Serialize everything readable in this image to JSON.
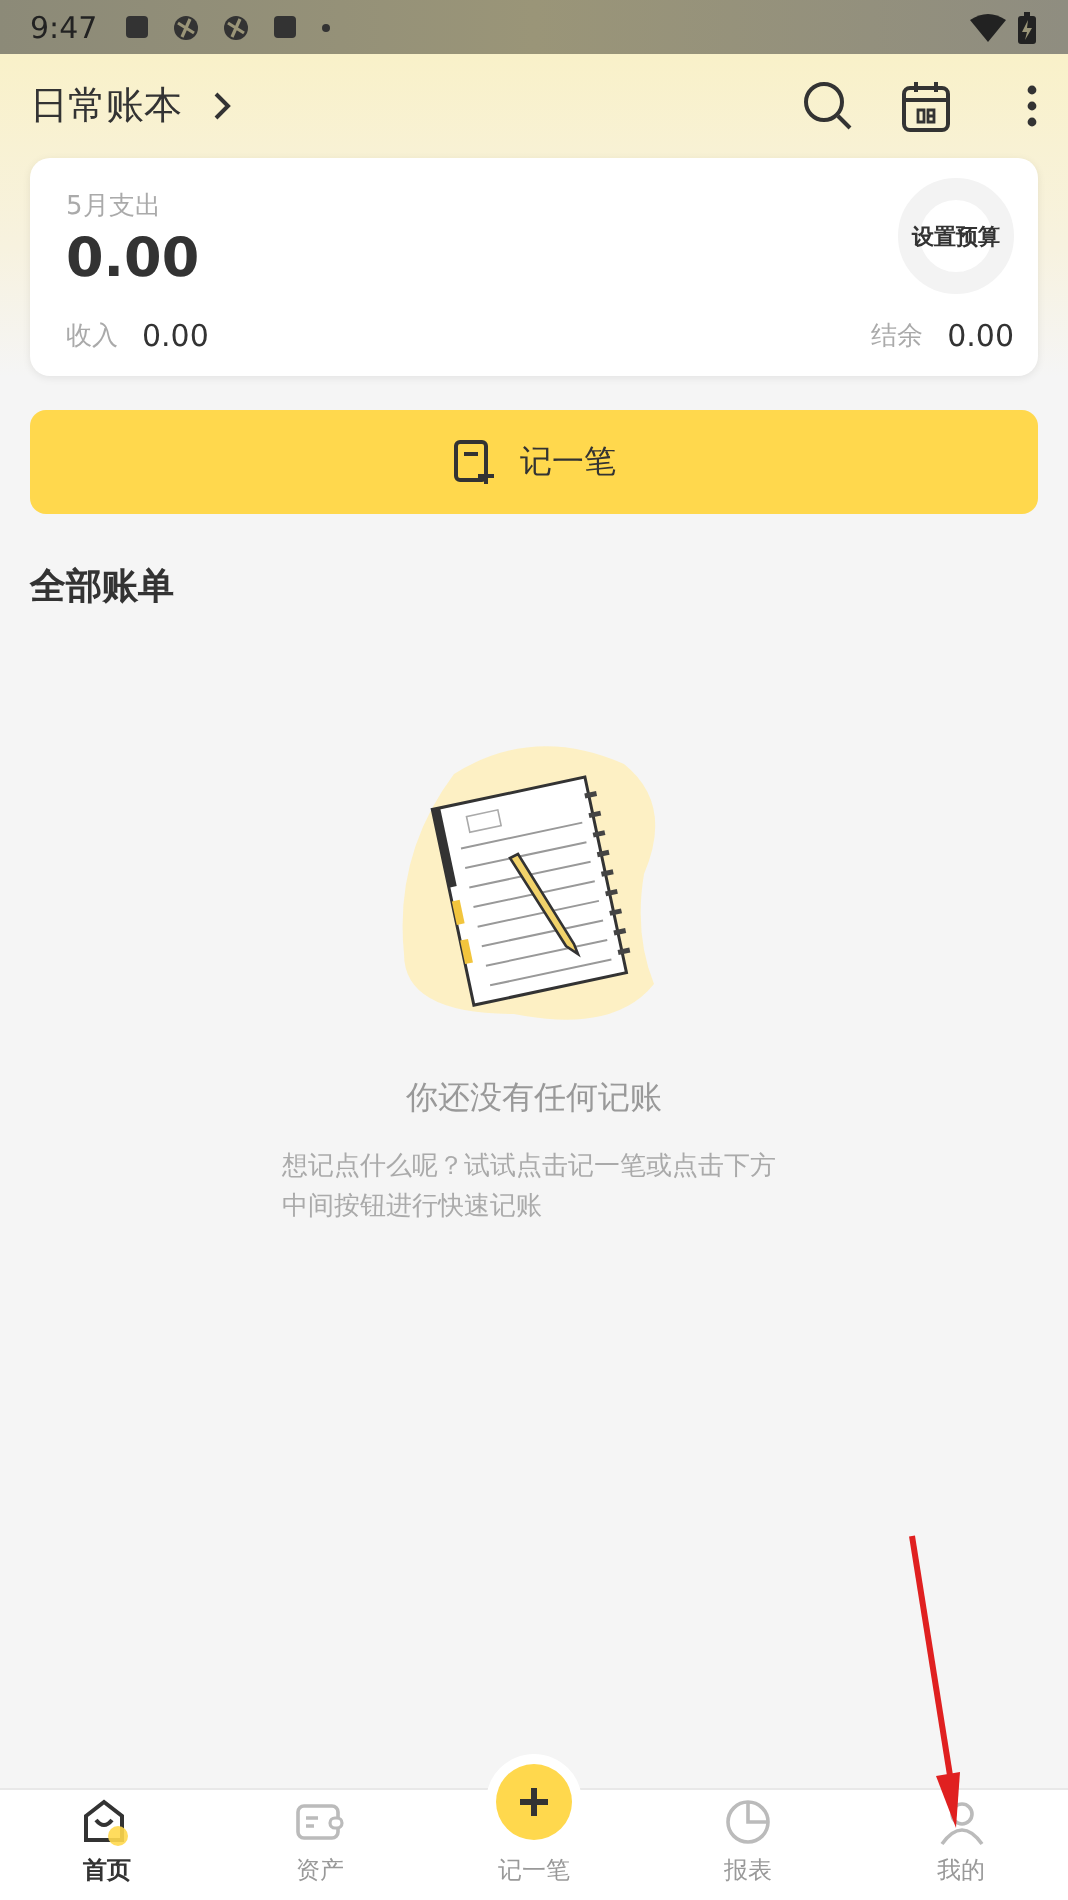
{
  "status_bar": {
    "time": "9:47"
  },
  "header": {
    "title": "日常账本"
  },
  "summary": {
    "month_label": "5月支出",
    "expense": "0.00",
    "budget_button": "设置预算",
    "income_label": "收入",
    "income": "0.00",
    "balance_label": "结余",
    "balance": "0.00"
  },
  "add_button": {
    "label": "记一笔"
  },
  "section_title": "全部账单",
  "empty_state": {
    "title": "你还没有任何记账",
    "message": "想记点什么呢？试试点击记一笔或点击下方中间按钮进行快速记账"
  },
  "bottom_nav": [
    {
      "kind": "home",
      "label": "首页",
      "selected": true
    },
    {
      "kind": "wallet",
      "label": "资产",
      "selected": false
    },
    {
      "kind": "add",
      "label": "记一笔",
      "selected": false
    },
    {
      "kind": "report",
      "label": "报表",
      "selected": false
    },
    {
      "kind": "profile",
      "label": "我的",
      "selected": false
    }
  ]
}
